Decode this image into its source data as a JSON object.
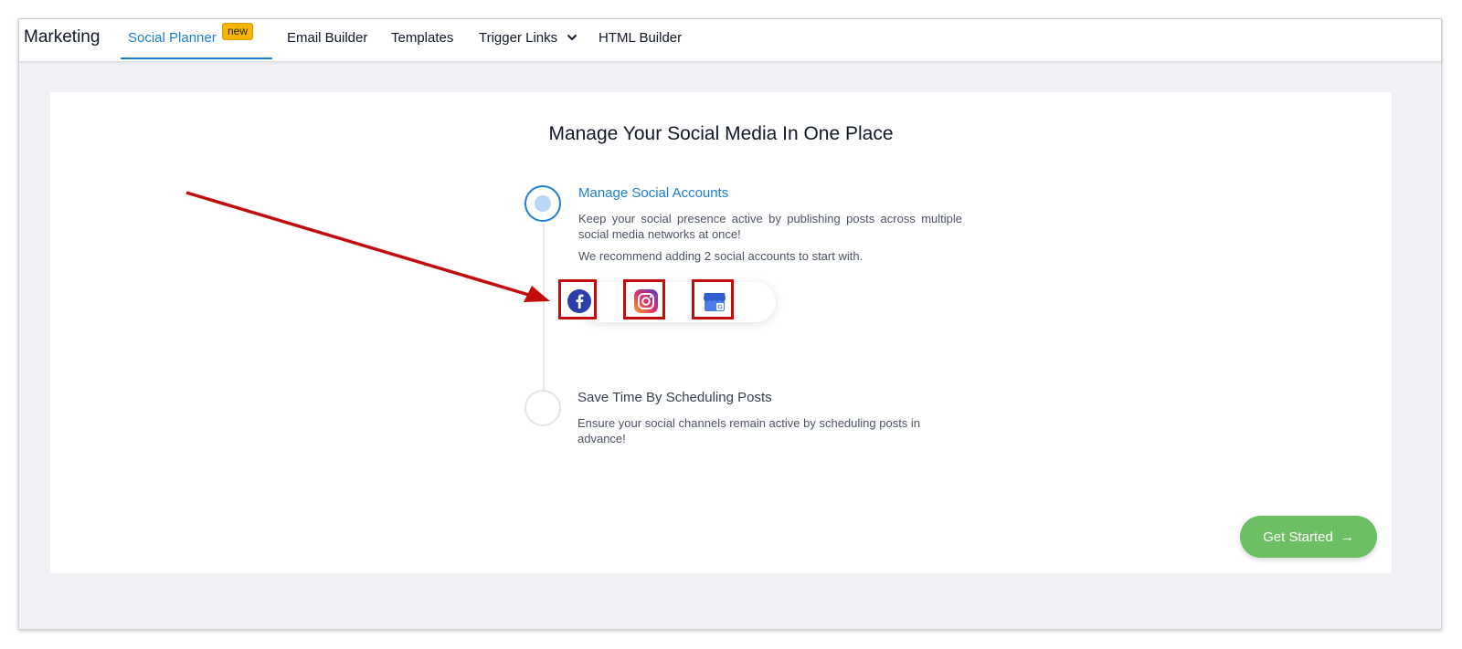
{
  "header": {
    "brand": "Marketing",
    "tabs": [
      {
        "label": "Social Planner",
        "badge": "new",
        "active": true
      },
      {
        "label": "Email Builder"
      },
      {
        "label": "Templates"
      },
      {
        "label": "Trigger Links"
      },
      {
        "label": "HTML Builder"
      }
    ]
  },
  "main": {
    "title": "Manage Your Social Media In One Place",
    "steps": [
      {
        "title": "Manage Social Accounts",
        "description": "Keep your social presence active by publishing posts across multiple social media networks at once!",
        "recommendation": "We recommend adding 2 social accounts to start with.",
        "accounts": [
          "facebook-icon",
          "instagram-icon",
          "google-business-icon"
        ]
      },
      {
        "title": "Save Time By Scheduling Posts",
        "description": "Ensure your social channels remain active by scheduling posts in advance!"
      }
    ],
    "cta": {
      "label": "Get Started",
      "arrow": "→"
    }
  },
  "colors": {
    "accent": "#1d7fd6",
    "badge": "#f7b500",
    "cta": "#6cbf63",
    "highlight": "#c30d0d"
  }
}
